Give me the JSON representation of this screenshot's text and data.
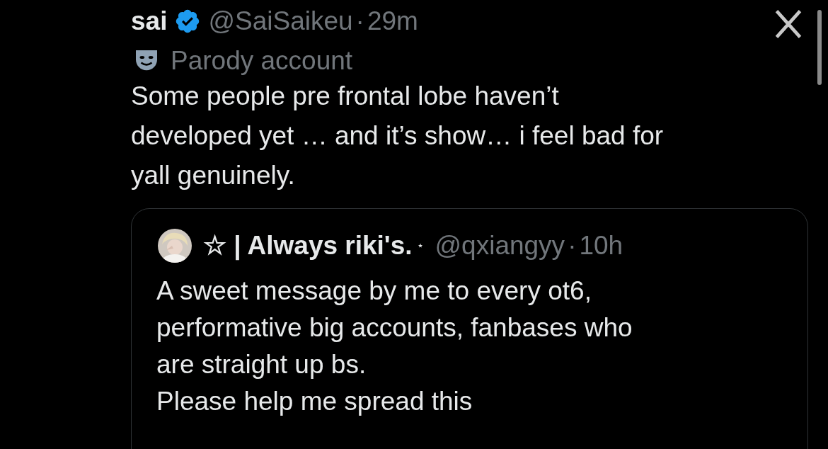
{
  "post": {
    "name": "sai",
    "verified": true,
    "handle": "@SaiSaikeu",
    "separator": "·",
    "time": "29m",
    "label": "Parody account",
    "text": "Some people pre frontal lobe haven’t\ndeveloped yet … and it’s show… i feel bad for\nyall genuinely."
  },
  "quote": {
    "name": "☆ | Always riki's.",
    "name_mark": "⋆",
    "handle": "@qxiangyy",
    "separator": "·",
    "time": "10h",
    "text": "A sweet message by me to every ot6,\nperformative big accounts, fanbases who\nare straight up bs.\nPlease help me spread this"
  }
}
